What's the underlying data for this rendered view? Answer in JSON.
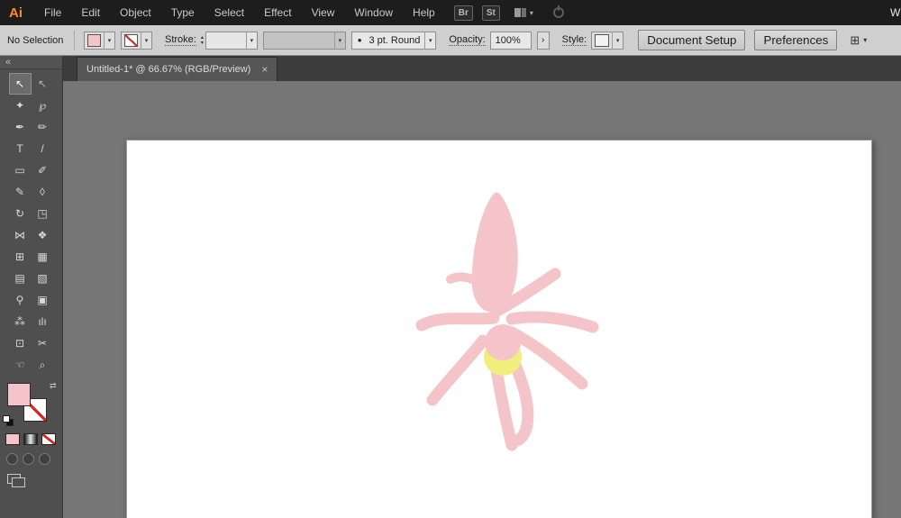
{
  "menu": {
    "logo": "Ai",
    "items": [
      "File",
      "Edit",
      "Object",
      "Type",
      "Select",
      "Effect",
      "View",
      "Window",
      "Help"
    ],
    "bridge": "Br",
    "stock": "St",
    "partial_right": "W"
  },
  "control_bar": {
    "selection_status": "No Selection",
    "stroke_label": "Stroke:",
    "stroke_width_value": "",
    "brush_bullet": "•",
    "brush_preset": "3 pt. Round",
    "opacity_label": "Opacity:",
    "opacity_value": "100%",
    "style_label": "Style:",
    "document_setup": "Document Setup",
    "preferences": "Preferences"
  },
  "ui": {
    "caret": "▾",
    "spinner_up": "▴",
    "spinner_down": "▾",
    "more_arrow": "›",
    "align_glyph": "⊞"
  },
  "tab": {
    "title": "Untitled-1* @ 66.67% (RGB/Preview)",
    "close": "×"
  },
  "dock": {
    "collapse": "«",
    "swap": "⇄",
    "tools": [
      {
        "name": "selection-tool",
        "glyph": "↖"
      },
      {
        "name": "direct-selection-tool",
        "glyph": "↖"
      },
      {
        "name": "magic-wand-tool",
        "glyph": "✦"
      },
      {
        "name": "lasso-tool",
        "glyph": "℘"
      },
      {
        "name": "pen-tool",
        "glyph": "✒"
      },
      {
        "name": "curvature-tool",
        "glyph": "✏"
      },
      {
        "name": "type-tool",
        "glyph": "T"
      },
      {
        "name": "line-segment-tool",
        "glyph": "/"
      },
      {
        "name": "rectangle-tool",
        "glyph": "▭"
      },
      {
        "name": "paintbrush-tool",
        "glyph": "✐"
      },
      {
        "name": "pencil-tool",
        "glyph": "✎"
      },
      {
        "name": "eraser-tool",
        "glyph": "◊"
      },
      {
        "name": "rotate-tool",
        "glyph": "↻"
      },
      {
        "name": "scale-tool",
        "glyph": "◳"
      },
      {
        "name": "width-tool",
        "glyph": "⋈"
      },
      {
        "name": "shape-builder-tool",
        "glyph": "❖"
      },
      {
        "name": "free-transform-tool",
        "glyph": "⊞"
      },
      {
        "name": "perspective-grid-tool",
        "glyph": "▦"
      },
      {
        "name": "mesh-tool",
        "glyph": "▤"
      },
      {
        "name": "gradient-tool",
        "glyph": "▧"
      },
      {
        "name": "eyedropper-tool",
        "glyph": "⚲"
      },
      {
        "name": "blend-tool",
        "glyph": "▣"
      },
      {
        "name": "symbol-sprayer-tool",
        "glyph": "⁂"
      },
      {
        "name": "column-graph-tool",
        "glyph": "ılı"
      },
      {
        "name": "artboard-tool",
        "glyph": "⊡"
      },
      {
        "name": "slice-tool",
        "glyph": "✂"
      },
      {
        "name": "hand-tool",
        "glyph": "☜"
      },
      {
        "name": "zoom-tool",
        "glyph": "⌕"
      }
    ]
  },
  "artwork": {
    "pink": "#f5c4c8",
    "yellow": "#f1ee7e"
  },
  "styles": {
    "pink_swatch": "background:#f5c4c8"
  }
}
